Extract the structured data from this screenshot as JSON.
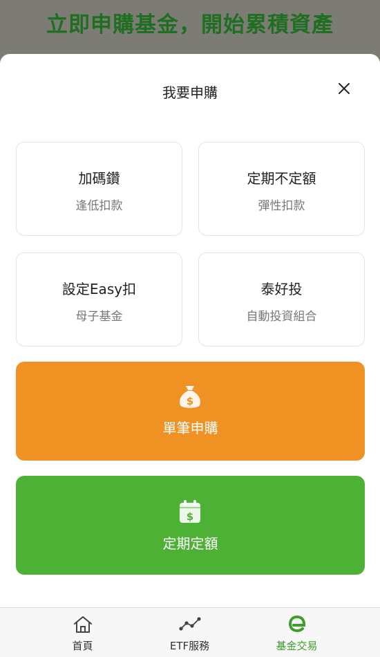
{
  "banner": {
    "title": "立即申購基金，開始累積資產"
  },
  "sheet": {
    "title": "我要申購",
    "close_icon": "close-icon",
    "options": [
      {
        "title": "加碼鑽",
        "subtitle": "逢低扣款"
      },
      {
        "title": "定期不定額",
        "subtitle": "彈性扣款"
      },
      {
        "title": "設定Easy扣",
        "subtitle": "母子基金"
      },
      {
        "title": "泰好投",
        "subtitle": "自動投資組合"
      }
    ],
    "single_purchase": {
      "label": "單筆申購",
      "icon": "money-bag-icon",
      "color": "#f09223"
    },
    "regular_purchase": {
      "label": "定期定額",
      "icon": "calendar-dollar-icon",
      "color": "#4cb135"
    }
  },
  "tabbar": {
    "tabs": [
      {
        "label": "首頁",
        "icon": "home-icon"
      },
      {
        "label": "ETF服務",
        "icon": "trend-line-icon"
      },
      {
        "label": "基金交易",
        "icon": "e-logo-icon"
      }
    ],
    "active_color": "#3f9e2b"
  }
}
